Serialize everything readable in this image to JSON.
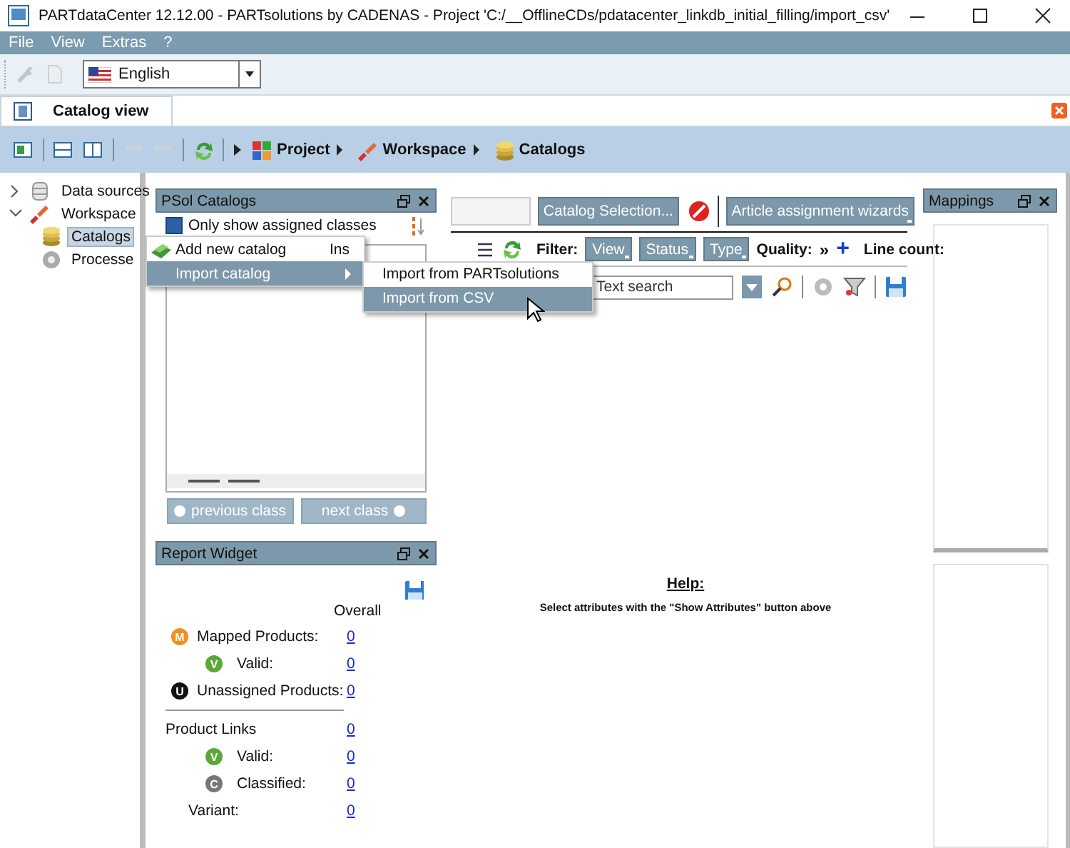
{
  "window": {
    "title": "PARTdataCenter 12.12.00 - PARTsolutions by CADENAS - Project 'C:/__OfflineCDs/pdatacenter_linkdb_initial_filling/import_csv'"
  },
  "menu_bar": [
    {
      "label": "File"
    },
    {
      "label": "View"
    },
    {
      "label": "Extras"
    },
    {
      "label": "?"
    }
  ],
  "toolbar": {
    "language": "English"
  },
  "tabs": [
    {
      "label": "Catalog view",
      "selected": true
    }
  ],
  "breadcrumb": [
    {
      "label": "Project"
    },
    {
      "label": "Workspace"
    },
    {
      "label": "Catalogs"
    }
  ],
  "tree": [
    {
      "label": "Data sources",
      "expanded": false,
      "selected": false
    },
    {
      "label": "Workspace",
      "expanded": true,
      "selected": false,
      "children": [
        {
          "label": "Catalogs",
          "selected": true
        },
        {
          "label": "Processe",
          "selected": false
        }
      ]
    }
  ],
  "psol_panel": {
    "title": "PSol Catalogs",
    "checkbox": {
      "label": "Only show assigned classes",
      "checked": true
    },
    "buttons": [
      {
        "label": "previous class",
        "disabled": true
      },
      {
        "label": "next class",
        "disabled": true
      }
    ]
  },
  "report_widget": {
    "title": "Report Widget",
    "column": "Overall",
    "sections": [
      {
        "rows": [
          {
            "kind": "main",
            "badge": "M",
            "color": "#f0901e",
            "label": "Mapped Products:",
            "value": "0"
          },
          {
            "kind": "sub",
            "badge": "V",
            "color": "#5aa83a",
            "label": "Valid:",
            "value": "0"
          },
          {
            "kind": "main",
            "badge": "U",
            "color": "#111111",
            "label": "Unassigned Products:",
            "value": "0"
          }
        ]
      },
      {
        "rows": [
          {
            "kind": "header",
            "label": "Product Links",
            "value": "0"
          },
          {
            "kind": "sub",
            "badge": "V",
            "color": "#5aa83a",
            "label": "Valid:",
            "value": "0"
          },
          {
            "kind": "sub",
            "badge": "C",
            "color": "#777777",
            "label": "Classified:",
            "value": "0"
          },
          {
            "kind": "plain",
            "label": "Variant:",
            "value": "0"
          }
        ]
      }
    ]
  },
  "assignment": {
    "buttons": [
      {
        "label": "Catalog Selection...",
        "dropdown": false
      },
      {
        "label": "Article assignment wizards",
        "dropdown": true
      }
    ],
    "filter": {
      "label": "Filter:",
      "dropdowns": [
        {
          "label": "View"
        },
        {
          "label": "Status"
        },
        {
          "label": "Type"
        }
      ],
      "quality": "Quality:",
      "more": "»",
      "add": "+",
      "line_count": "Line count:"
    },
    "search": {
      "placeholder": "Text search"
    }
  },
  "help": {
    "title": "Help:",
    "text": "Select attributes with the \"Show Attributes\" button above"
  },
  "mappings": {
    "title": "Mappings"
  },
  "context_menu": {
    "items": [
      {
        "label": "Add new catalog",
        "shortcut": "Ins",
        "selected": false
      },
      {
        "label": "Import catalog",
        "selected": true,
        "submenu": [
          {
            "label": "Import from PARTsolutions",
            "selected": false
          },
          {
            "label": "Import from CSV",
            "selected": true
          }
        ]
      }
    ]
  }
}
